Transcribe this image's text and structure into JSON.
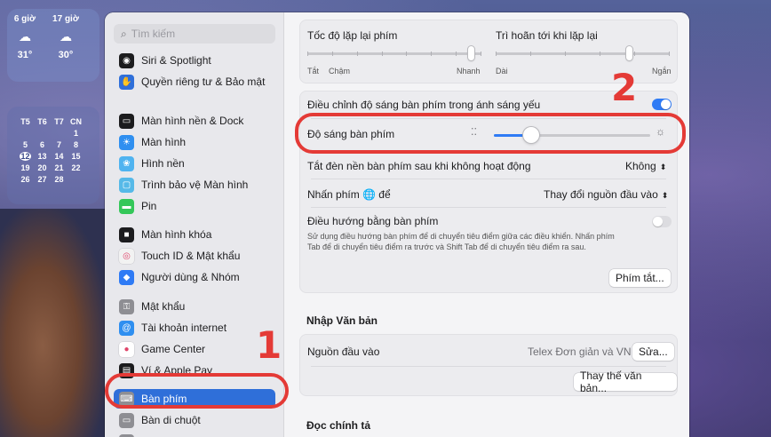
{
  "desktop": {
    "weather": [
      {
        "time": "6 giờ",
        "temp": "31°"
      },
      {
        "time": "17 giờ",
        "temp": "30°"
      }
    ],
    "calendar": {
      "header": [
        "T5",
        "T6",
        "T7",
        "CN"
      ],
      "rows": [
        [
          "",
          "",
          "",
          "1"
        ],
        [
          "5",
          "6",
          "7",
          "8"
        ],
        [
          "12",
          "13",
          "14",
          "15"
        ],
        [
          "19",
          "20",
          "21",
          "22"
        ],
        [
          "26",
          "27",
          "28",
          ""
        ]
      ],
      "today": "12"
    }
  },
  "sidebar": {
    "search_placeholder": "Tìm kiếm",
    "items": [
      {
        "label": "Siri & Spotlight",
        "icon": "siri-icon",
        "color": "#1c1c1e"
      },
      {
        "label": "Quyền riêng tư & Bảo mật",
        "icon": "hand-icon",
        "color": "#2f6fd9"
      },
      {
        "label": "Màn hình nền & Dock",
        "icon": "dock-icon",
        "color": "#1c1c1e"
      },
      {
        "label": "Màn hình",
        "icon": "sun-icon",
        "color": "#2f8ff0"
      },
      {
        "label": "Hình nền",
        "icon": "flower-icon",
        "color": "#4fb3f0"
      },
      {
        "label": "Trình bảo vệ Màn hình",
        "icon": "screensaver-icon",
        "color": "#56b9e8"
      },
      {
        "label": "Pin",
        "icon": "battery-icon",
        "color": "#34c759"
      },
      {
        "label": "Màn hình khóa",
        "icon": "lock-icon",
        "color": "#1c1c1e"
      },
      {
        "label": "Touch ID & Mật khẩu",
        "icon": "fingerprint-icon",
        "color": "#f2f2f2"
      },
      {
        "label": "Người dùng & Nhóm",
        "icon": "users-icon",
        "color": "#2f7bf5"
      },
      {
        "label": "Mật khẩu",
        "icon": "key-icon",
        "color": "#8e8e93"
      },
      {
        "label": "Tài khoản internet",
        "icon": "at-icon",
        "color": "#2f8ff0"
      },
      {
        "label": "Game Center",
        "icon": "gamecenter-icon",
        "color": "#ffffff"
      },
      {
        "label": "Ví & Apple Pay",
        "icon": "wallet-icon",
        "color": "#1c1c1e"
      },
      {
        "label": "Bàn phím",
        "icon": "keyboard-icon",
        "color": "#8e8e93",
        "selected": true
      },
      {
        "label": "Bàn di chuột",
        "icon": "trackpad-icon",
        "color": "#8e8e93"
      },
      {
        "label": "Máy in & Máy quét",
        "icon": "printer-icon",
        "color": "#8e8e93"
      }
    ]
  },
  "keyboard": {
    "repeat_rate_label": "Tốc độ lặp lại phím",
    "repeat_rate_min": "Tắt",
    "repeat_rate_slow": "Chậm",
    "repeat_rate_fast": "Nhanh",
    "repeat_delay_label": "Trì hoãn tới khi lặp lại",
    "repeat_delay_long": "Dài",
    "repeat_delay_short": "Ngắn",
    "repeat_rate_value": 0.96,
    "repeat_delay_value": 0.78,
    "auto_brightness_label": "Điều chỉnh độ sáng bàn phím trong ánh sáng yếu",
    "auto_brightness_on": true,
    "brightness_label": "Độ sáng bàn phím",
    "brightness_value": 0.21,
    "backlight_off_label": "Tắt đèn nền bàn phím sau khi không hoạt động",
    "backlight_off_value": "Không",
    "globe_label": "Nhấn phím 🌐 để",
    "globe_value": "Thay đổi nguồn đầu vào",
    "nav_label": "Điều hướng bằng bàn phím",
    "nav_on": false,
    "nav_desc_1": "Sử dụng điều hướng bàn phím để di chuyển tiêu điểm giữa các điều khiển. Nhấn phím",
    "nav_desc_2": "Tab để di chuyển tiêu điểm ra trước và Shift Tab để di chuyển tiêu điểm ra sau.",
    "shortcuts_button": "Phím tắt...",
    "text_input_title": "Nhập Văn bản",
    "input_sources_label": "Nguồn đầu vào",
    "input_sources_value": "Telex Đơn giản và VNI",
    "edit_button": "Sửa...",
    "text_replace_button": "Thay thế văn bản...",
    "dictation_title": "Đọc chính tả"
  },
  "annotations": {
    "step1": "1",
    "step2": "2",
    "color": "#e43a36"
  }
}
